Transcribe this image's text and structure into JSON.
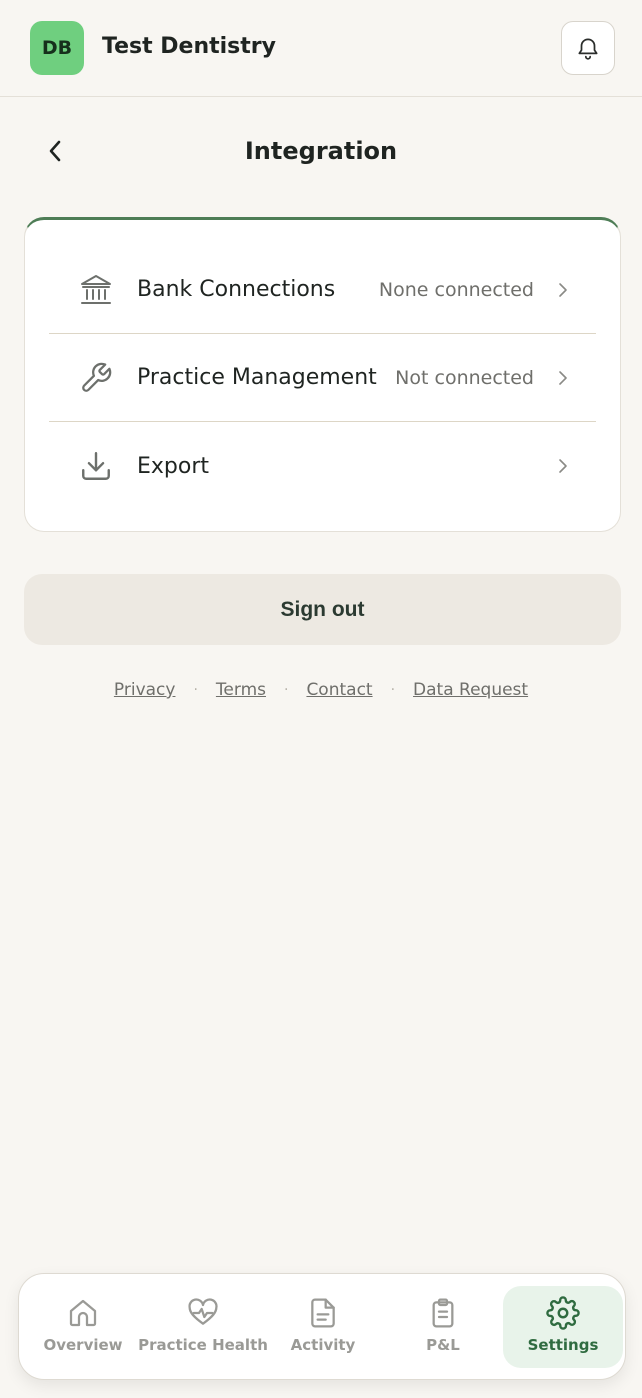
{
  "header": {
    "avatar_initials": "DB",
    "practice_name": "Test Dentistry",
    "bell_icon": "bell-icon"
  },
  "page": {
    "title": "Integration",
    "back_icon": "chevron-left-icon"
  },
  "integrations": [
    {
      "icon": "bank-icon",
      "label": "Bank Connections",
      "status": "None connected"
    },
    {
      "icon": "wrench-icon",
      "label": "Practice Management",
      "status": "Not connected"
    },
    {
      "icon": "download-icon",
      "label": "Export",
      "status": ""
    }
  ],
  "signout_label": "Sign out",
  "footer": {
    "links": [
      "Privacy",
      "Terms",
      "Contact",
      "Data Request"
    ],
    "separator": "·"
  },
  "nav": {
    "items": [
      {
        "label": "Overview",
        "icon": "home-icon",
        "active": false
      },
      {
        "label": "Practice Health",
        "icon": "heart-pulse-icon",
        "active": false
      },
      {
        "label": "Activity",
        "icon": "document-icon",
        "active": false
      },
      {
        "label": "P&L",
        "icon": "clipboard-icon",
        "active": false
      },
      {
        "label": "Settings",
        "icon": "gear-icon",
        "active": true
      }
    ]
  },
  "colors": {
    "background": "#f8f6f2",
    "accent": "#4e7d56",
    "avatar": "#6fcf7f",
    "active_nav_bg": "#e8f3ea"
  }
}
